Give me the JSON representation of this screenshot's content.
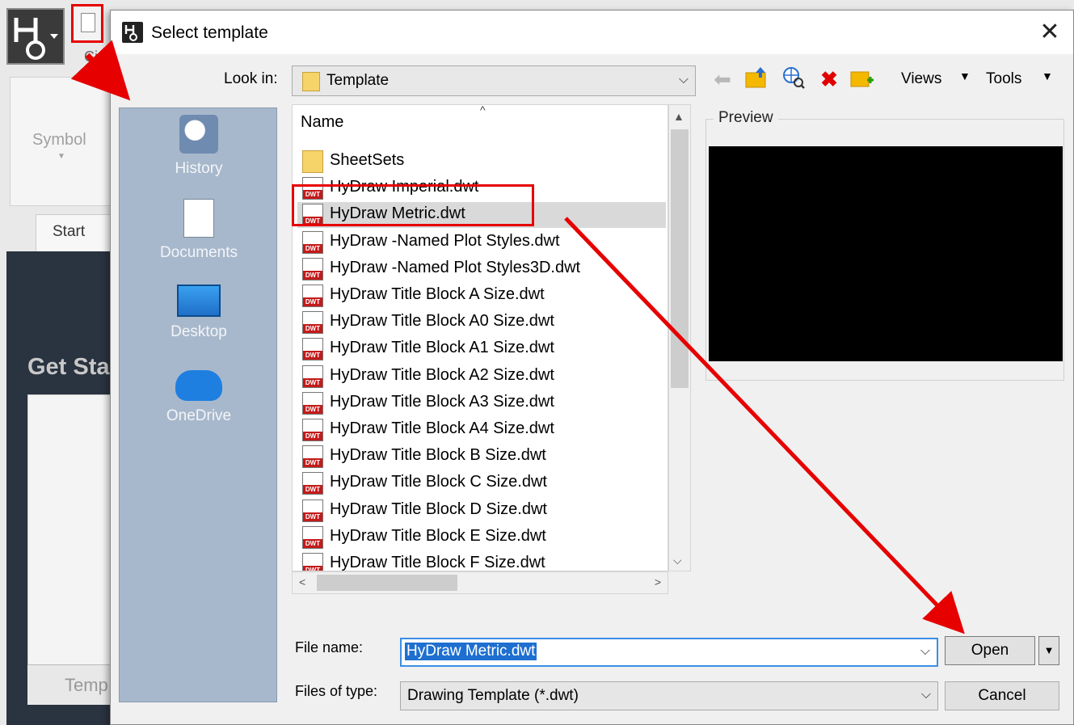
{
  "background_app": {
    "ribbon_tab_partial": "Cir",
    "symbol_label": "Symbol",
    "start_tab": "Start",
    "get_started_partial": "Get Sta",
    "template_partial": "Temp"
  },
  "dialog": {
    "title": "Select template",
    "close_glyph": "✕",
    "look_in_label": "Look in:",
    "look_in_value": "Template",
    "toolbar": {
      "views": "Views",
      "tools": "Tools"
    },
    "places": [
      {
        "label": "History",
        "icon": "history-icon"
      },
      {
        "label": "Documents",
        "icon": "documents-icon"
      },
      {
        "label": "Desktop",
        "icon": "desktop-icon"
      },
      {
        "label": "OneDrive",
        "icon": "onedrive-icon"
      }
    ],
    "file_list": {
      "column_header": "Name",
      "items": [
        {
          "name": "SheetSets",
          "type": "folder"
        },
        {
          "name": "HyDraw Imperial.dwt",
          "type": "dwt"
        },
        {
          "name": "HyDraw Metric.dwt",
          "type": "dwt",
          "selected": true
        },
        {
          "name": "HyDraw -Named Plot Styles.dwt",
          "type": "dwt"
        },
        {
          "name": "HyDraw -Named Plot Styles3D.dwt",
          "type": "dwt"
        },
        {
          "name": "HyDraw Title Block A Size.dwt",
          "type": "dwt"
        },
        {
          "name": "HyDraw Title Block A0 Size.dwt",
          "type": "dwt"
        },
        {
          "name": "HyDraw Title Block A1 Size.dwt",
          "type": "dwt"
        },
        {
          "name": "HyDraw Title Block A2 Size.dwt",
          "type": "dwt"
        },
        {
          "name": "HyDraw Title Block A3 Size.dwt",
          "type": "dwt"
        },
        {
          "name": "HyDraw Title Block A4 Size.dwt",
          "type": "dwt"
        },
        {
          "name": "HyDraw Title Block B Size.dwt",
          "type": "dwt"
        },
        {
          "name": "HyDraw Title Block C Size.dwt",
          "type": "dwt"
        },
        {
          "name": "HyDraw Title Block D Size.dwt",
          "type": "dwt"
        },
        {
          "name": "HyDraw Title Block E Size.dwt",
          "type": "dwt"
        },
        {
          "name": "HyDraw Title Block F Size.dwt",
          "type": "dwt"
        }
      ],
      "file_badge": "DWT"
    },
    "preview_label": "Preview",
    "file_name_label": "File name:",
    "file_name_value": "HyDraw Metric.dwt",
    "files_of_type_label": "Files of type:",
    "files_of_type_value": "Drawing Template (*.dwt)",
    "open_button": "Open",
    "cancel_button": "Cancel"
  },
  "colors": {
    "annotation_red": "#e60000",
    "selection_blue": "#1e6fd0",
    "places_bar": "#a8b8cc"
  }
}
